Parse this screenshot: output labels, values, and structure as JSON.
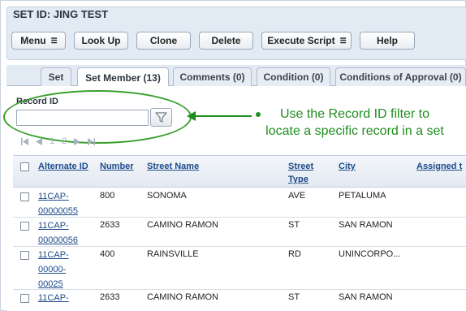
{
  "header": {
    "set_id": "SET ID: JING TEST",
    "buttons": {
      "menu": "Menu",
      "look_up": "Look Up",
      "clone": "Clone",
      "delete": "Delete",
      "execute_script": "Execute Script",
      "help": "Help"
    }
  },
  "tabs": [
    {
      "label": "Set",
      "active": false
    },
    {
      "label": "Set Member (13)",
      "active": true
    },
    {
      "label": "Comments (0)",
      "active": false
    },
    {
      "label": "Condition (0)",
      "active": false
    },
    {
      "label": "Conditions of Approval (0)",
      "active": false
    }
  ],
  "filter": {
    "label": "Record ID",
    "value": "",
    "icon": "funnel-filter-icon"
  },
  "callout": {
    "line1": "Use the Record ID filter to",
    "line2": "locate a specific record in a set",
    "color": "#1f8e1f"
  },
  "pager": {
    "page_1": "1",
    "page_2": "2"
  },
  "table": {
    "columns": {
      "alternate_id": "Alternate ID",
      "number": "Number",
      "street_name": "Street Name",
      "street_type_1": "Street",
      "street_type_2": "Type",
      "city": "City",
      "assigned": "Assigned t"
    },
    "rows": [
      {
        "id_1": "11CAP-",
        "id_2": "00000055",
        "id_3": "",
        "number": "800",
        "street": "SONOMA",
        "type": "AVE",
        "city": "PETALUMA"
      },
      {
        "id_1": "11CAP-",
        "id_2": "00000056",
        "id_3": "",
        "number": "2633",
        "street": "CAMINO RAMON",
        "type": "ST",
        "city": "SAN RAMON"
      },
      {
        "id_1": "11CAP-",
        "id_2": "00000-",
        "id_3": "00025",
        "number": "400",
        "street": "RAINSVILLE",
        "type": "RD",
        "city": "UNINCORPO..."
      },
      {
        "id_1": "11CAP-",
        "id_2": "",
        "id_3": "",
        "number": "2633",
        "street": "CAMINO RAMON",
        "type": "ST",
        "city": "SAN RAMON"
      }
    ]
  }
}
